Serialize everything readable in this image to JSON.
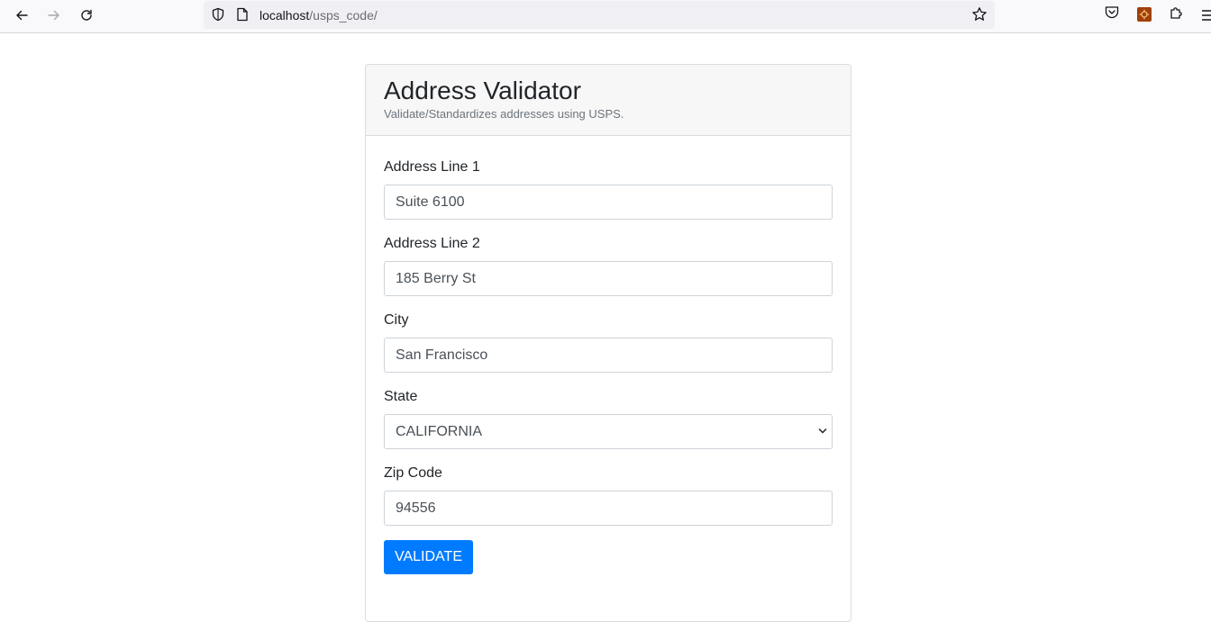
{
  "browser": {
    "url_host": "localhost",
    "url_path": "/usps_code/"
  },
  "icons": {
    "back": "arrow-left-icon",
    "forward": "arrow-right-icon",
    "reload": "reload-icon",
    "shield": "shield-icon",
    "page": "page-icon",
    "bookmark": "star-icon",
    "pocket": "pocket-icon",
    "extension": "extension-icon",
    "extensions_menu": "puzzle-icon",
    "menu": "hamburger-menu-icon"
  },
  "card": {
    "title": "Address Validator",
    "subtitle": "Validate/Standardizes addresses using USPS."
  },
  "form": {
    "address1": {
      "label": "Address Line 1",
      "value": "Suite 6100"
    },
    "address2": {
      "label": "Address Line 2",
      "value": "185 Berry St"
    },
    "city": {
      "label": "City",
      "value": "San Francisco"
    },
    "state": {
      "label": "State",
      "value": "CALIFORNIA"
    },
    "zip": {
      "label": "Zip Code",
      "value": "94556"
    },
    "submit_label": "VALIDATE"
  },
  "colors": {
    "primary": "#007bff",
    "header_bg": "#f7f7f7",
    "extension_badge": "#a0400a"
  }
}
